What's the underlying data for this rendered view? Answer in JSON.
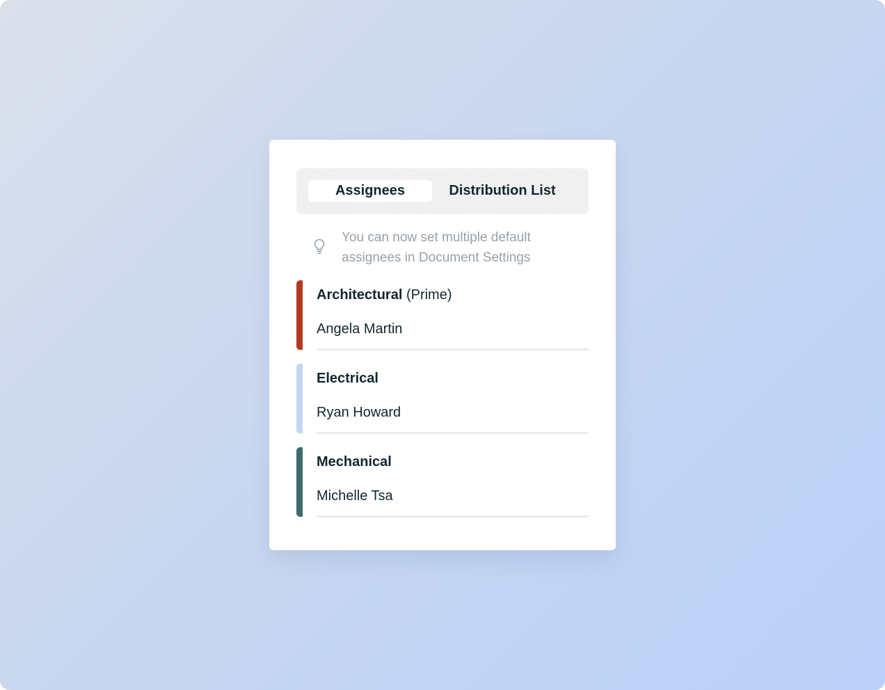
{
  "tabs": [
    {
      "label": "Assignees",
      "active": true
    },
    {
      "label": "Distribution List",
      "active": false
    }
  ],
  "tip": {
    "icon": "lightbulb-icon",
    "text": "You can now set multiple default assignees in Document Settings"
  },
  "groups": [
    {
      "title": "Architectural",
      "suffix": "(Prime)",
      "assignee": "Angela Martin",
      "color": "#b33a22"
    },
    {
      "title": "Electrical",
      "suffix": "",
      "assignee": "Ryan Howard",
      "color": "#c3d6f4"
    },
    {
      "title": "Mechanical",
      "suffix": "",
      "assignee": "Michelle Tsa",
      "color": "#3f6b6d"
    }
  ]
}
